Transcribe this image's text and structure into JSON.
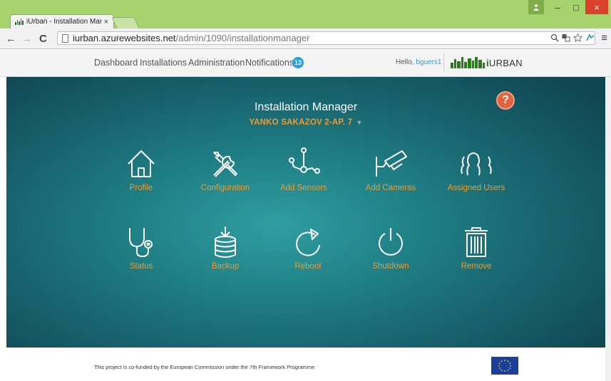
{
  "browser": {
    "tab_title": "iUrban - Installation Mana",
    "tab_close": "×",
    "url_host": "iurban.azurewebsites.net",
    "url_path": "/admin/1090/installationmanager",
    "back": "←",
    "forward": "→",
    "reload": "C",
    "menu": "≡",
    "win_min": "–",
    "win_max": "□",
    "win_close": "×"
  },
  "nav": {
    "dashboard": "Dashboard",
    "installations": "Installations",
    "administration": "Administration",
    "notifications": "Notifications",
    "notif_count": "13",
    "hello": "Hello,",
    "user": "bguers1",
    "brand_i": "i",
    "brand": "URBAN"
  },
  "hero": {
    "title": "Installation Manager",
    "installation": "YANKO SAKAZOV 2-AP. 7",
    "caret": "▼",
    "help": "?"
  },
  "actions": [
    {
      "label": "Profile",
      "icon": "home-icon"
    },
    {
      "label": "Configuration",
      "icon": "tools-icon"
    },
    {
      "label": "Add Sensors",
      "icon": "sensor-network-icon"
    },
    {
      "label": "Add Cameras",
      "icon": "camera-icon"
    },
    {
      "label": "Assigned Users",
      "icon": "users-icon"
    },
    {
      "label": "Status",
      "icon": "stethoscope-icon"
    },
    {
      "label": "Backup",
      "icon": "database-backup-icon"
    },
    {
      "label": "Reboot",
      "icon": "reboot-icon"
    },
    {
      "label": "Shutdown",
      "icon": "power-icon"
    },
    {
      "label": "Remove",
      "icon": "trash-icon"
    }
  ],
  "footer": {
    "text": "This project is co-funded by the European Commission under the 7th Framework Programme"
  },
  "colors": {
    "accent_orange": "#f29a2e",
    "hero_teal": "#1f7f85",
    "badge_blue": "#2a9fd8",
    "help_red": "#e2623e",
    "chrome_green": "#a6d36b"
  }
}
